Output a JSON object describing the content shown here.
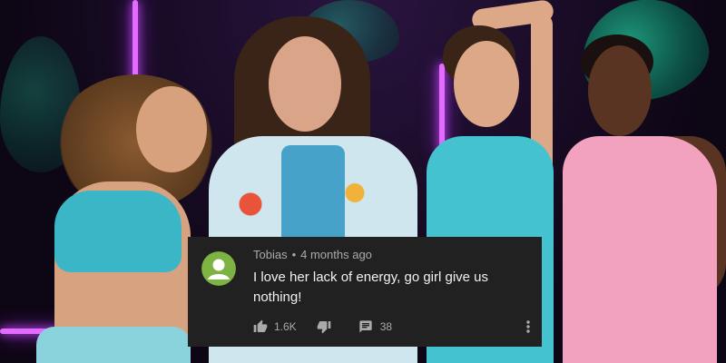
{
  "comment": {
    "author": "Tobias",
    "separator": "•",
    "time": "4 months ago",
    "text": "I love her lack of energy, go girl give us nothing!",
    "likes": "1.6K",
    "replies": "38"
  },
  "icons": {
    "avatar": "default-user-avatar-icon",
    "like": "thumbs-up-icon",
    "dislike": "thumbs-down-icon",
    "reply": "comment-icon",
    "more": "more-vertical-icon"
  },
  "colors": {
    "card_bg": "#212121",
    "meta_text": "#aaaaaa",
    "body_text": "#f1f1f1",
    "avatar_green": "#7cb342",
    "neon": "#e36cff"
  }
}
